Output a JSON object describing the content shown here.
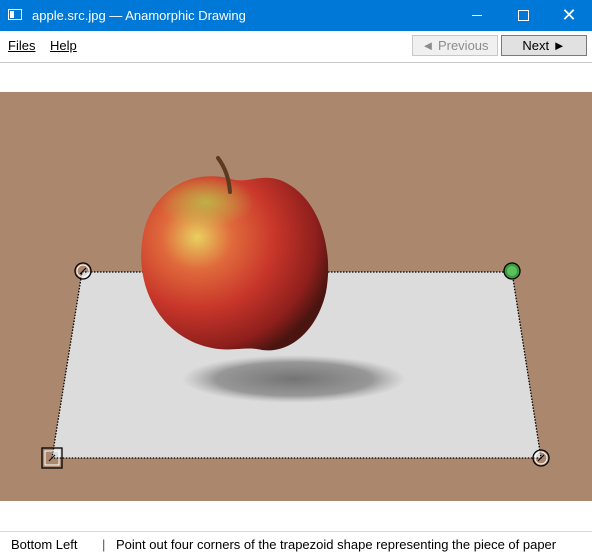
{
  "window": {
    "title": "apple.src.jpg — Anamorphic Drawing",
    "icon": "app-window-icon"
  },
  "menu": {
    "files_label": "Files",
    "help_label": "Help"
  },
  "nav": {
    "previous_label": "◄ Previous",
    "next_label": "Next ►"
  },
  "canvas": {
    "background_color": "#ab876e",
    "paper_color": "#dcdcdc",
    "handle_colors": {
      "default": "#000000",
      "active": "#3c9a3c"
    },
    "image_subject": "red apple above sheet of paper"
  },
  "status": {
    "corner": "Bottom Left",
    "separator": "|",
    "instruction": "Point out four corners of the trapezoid shape representing the piece of paper"
  }
}
